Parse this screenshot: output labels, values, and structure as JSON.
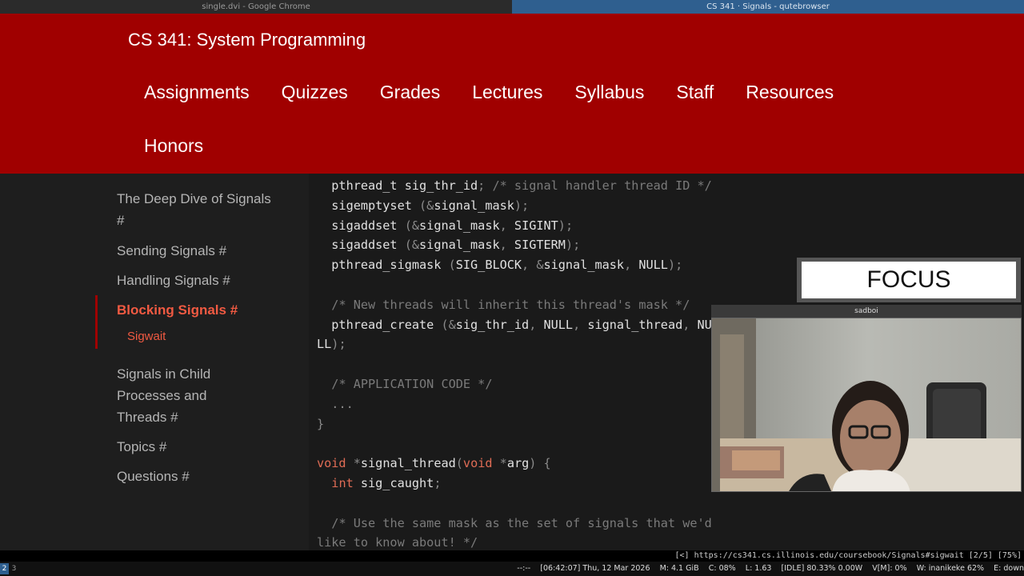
{
  "windows": {
    "left_title": "single.dvi - Google Chrome",
    "right_title": "CS 341 · Signals - qutebrowser"
  },
  "site": {
    "title": "CS 341: System Programming",
    "nav": [
      "Assignments",
      "Quizzes",
      "Grades",
      "Lectures",
      "Syllabus",
      "Staff",
      "Resources",
      "Honors"
    ]
  },
  "sidebar": {
    "items": [
      "The Deep Dive of Signals #",
      "Sending Signals #",
      "Handling Signals #",
      "Blocking Signals #",
      "Signals in Child Processes and Threads #",
      "Topics #",
      "Questions #"
    ],
    "sub_item": "Sigwait"
  },
  "focus_label": "FOCUS",
  "webcam_label": "sadboi",
  "status": {
    "url": "[<] https://cs341.cs.illinois.edu/coursebook/Signals#sigwait [2/5] [75%]",
    "workspaces": [
      "2",
      "3"
    ],
    "system": "--:--    [06:42:07] Thu, 12 Mar 2026    M: 4.1 GiB    C: 08%    L: 1.63    [IDLE] 80.33% 0.00W    V[M]: 0%    W: inanikeke 62%    E: down"
  }
}
